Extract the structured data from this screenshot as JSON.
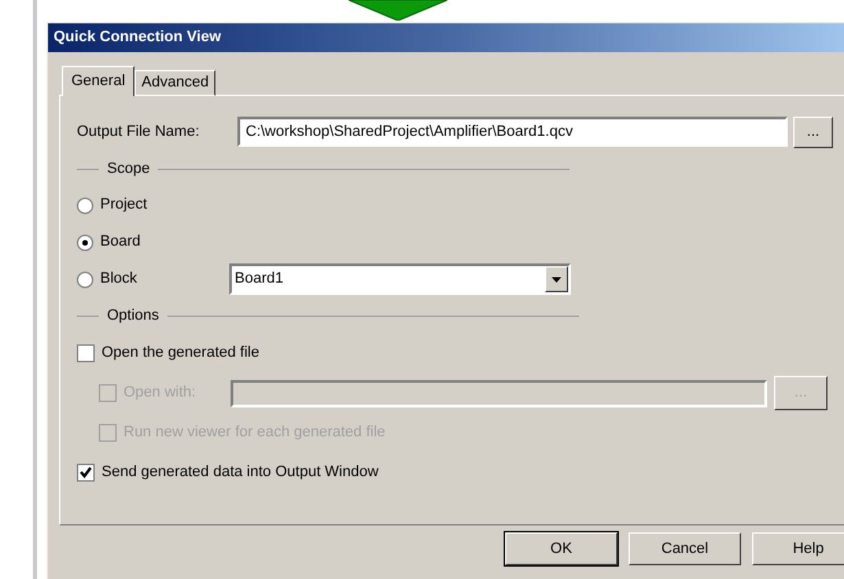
{
  "window": {
    "title": "Quick Connection View"
  },
  "tabs": [
    {
      "label": "General",
      "selected": true
    },
    {
      "label": "Advanced",
      "selected": false
    }
  ],
  "output_file": {
    "label": "Output File Name:",
    "value": "C:\\workshop\\SharedProject\\Amplifier\\Board1.qcv",
    "browse": "..."
  },
  "scope": {
    "title": "Scope",
    "options": [
      {
        "label": "Project",
        "selected": false
      },
      {
        "label": "Board",
        "selected": true
      },
      {
        "label": "Block",
        "selected": false
      }
    ],
    "block_value": "Board1"
  },
  "options": {
    "title": "Options",
    "open_file": {
      "label": "Open the generated file",
      "checked": false
    },
    "open_with": {
      "label": "Open with:",
      "checked": false,
      "disabled": true,
      "browse": "..."
    },
    "run_new": {
      "label": "Run new viewer for each generated file",
      "checked": false,
      "disabled": true
    },
    "send": {
      "label": "Send generated data into Output Window",
      "checked": true
    }
  },
  "buttons": [
    "OK",
    "Cancel",
    "Help"
  ]
}
